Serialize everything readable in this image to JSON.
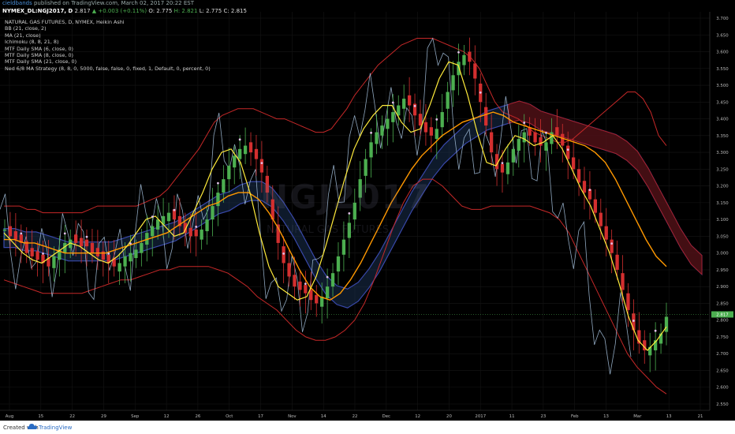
{
  "header": {
    "author": "cieldbands",
    "published": "published on TradingView.com, March 02, 2017 20:22 EST"
  },
  "symbol": {
    "ticker": "NYMEX_DL:NGJ2017, D",
    "last": "2.817",
    "change": "▲ +0.003 (+0.11%)",
    "o": "O: 2.775",
    "h": "H: 2.821",
    "l": "L: 2.775",
    "c": "C: 2.815"
  },
  "legend": {
    "title": "NATURAL GAS FUTURES, D, NYMEX, Heikin Ashi",
    "items": [
      "BB (21, close, 2)",
      "MA (21, close)",
      "Ichimoku (8, 8, 21, 8)",
      "MTF Daily SMA (6, close, 0)",
      "MTF Daily SMA (8, close, 0)",
      "MTF Daily SMA (21, close, 0)",
      "Ned 6/8 MA Strategy (8, 8, 0, 5000, false, false, 0, fixed, 1, Default, 0, percent, 0)"
    ]
  },
  "watermark": {
    "main": "NGJ2017",
    "sub": "NATURAL GAS FUTURES"
  },
  "footer": {
    "created": "Created with",
    "brand": "TradingView"
  },
  "colors": {
    "background": "#000000",
    "bull": "#4caf50",
    "bear": "#d32f2f",
    "bb_band": "#c62828",
    "ma21": "#ff9800",
    "sma6": "#ffeb3b",
    "kumo_bull": "#1e3a5f",
    "kumo_bear": "#5a0a0a",
    "chikou": "#a8c4e0",
    "price_label": "#4caf50"
  },
  "chart_data": {
    "type": "candlestick",
    "symbol": "NYMEX_DL:NGJ2017",
    "style": "Heikin Ashi",
    "y_axis": {
      "range": [
        2.55,
        3.7
      ],
      "ticks": [
        "3.700",
        "3.650",
        "3.600",
        "3.550",
        "3.500",
        "3.450",
        "3.400",
        "3.350",
        "3.300",
        "3.250",
        "3.200",
        "3.150",
        "3.100",
        "3.050",
        "3.000",
        "2.950",
        "2.900",
        "2.850",
        "2.800",
        "2.750",
        "2.700",
        "2.650",
        "2.600",
        "2.550"
      ],
      "last_price_label": "2.817"
    },
    "x_axis": {
      "ticks": [
        "Aug",
        "15",
        "22",
        "29",
        "Sep",
        "12",
        "26",
        "Oct",
        "17",
        "Nov",
        "14",
        "22",
        "Dec",
        "12",
        "20",
        "2017",
        "11",
        "23",
        "Feb",
        "13",
        "Mar",
        "13",
        "21"
      ]
    },
    "close_series": [
      3.07,
      3.05,
      3.04,
      3.03,
      3.0,
      2.99,
      2.98,
      2.97,
      2.96,
      2.99,
      3.01,
      3.03,
      3.04,
      3.03,
      3.02,
      3.02,
      3.0,
      2.99,
      2.98,
      2.97,
      2.96,
      2.97,
      2.99,
      3.0,
      3.01,
      3.03,
      3.06,
      3.08,
      3.1,
      3.11,
      3.12,
      3.1,
      3.08,
      3.06,
      3.05,
      3.05,
      3.07,
      3.1,
      3.14,
      3.18,
      3.22,
      3.26,
      3.29,
      3.31,
      3.32,
      3.3,
      3.28,
      3.24,
      3.18,
      3.1,
      3.03,
      2.97,
      2.93,
      2.9,
      2.89,
      2.88,
      2.86,
      2.85,
      2.87,
      2.9,
      2.94,
      2.99,
      3.04,
      3.09,
      3.15,
      3.22,
      3.28,
      3.33,
      3.36,
      3.38,
      3.4,
      3.42,
      3.44,
      3.46,
      3.44,
      3.41,
      3.38,
      3.36,
      3.35,
      3.37,
      3.42,
      3.48,
      3.53,
      3.57,
      3.59,
      3.57,
      3.52,
      3.45,
      3.38,
      3.3,
      3.25,
      3.24,
      3.27,
      3.31,
      3.34,
      3.36,
      3.35,
      3.33,
      3.32,
      3.33,
      3.36,
      3.35,
      3.32,
      3.28,
      3.25,
      3.21,
      3.18,
      3.16,
      3.12,
      3.08,
      3.04,
      3.0,
      2.95,
      2.89,
      2.83,
      2.77,
      2.73,
      2.71,
      2.72,
      2.74,
      2.76,
      2.81
    ],
    "bb_upper": [
      3.14,
      3.14,
      3.14,
      3.13,
      3.13,
      3.12,
      3.12,
      3.12,
      3.12,
      3.12,
      3.12,
      3.13,
      3.14,
      3.14,
      3.14,
      3.14,
      3.14,
      3.14,
      3.15,
      3.16,
      3.17,
      3.19,
      3.22,
      3.25,
      3.28,
      3.31,
      3.35,
      3.39,
      3.41,
      3.42,
      3.43,
      3.43,
      3.43,
      3.42,
      3.41,
      3.4,
      3.4,
      3.39,
      3.38,
      3.37,
      3.36,
      3.36,
      3.37,
      3.4,
      3.43,
      3.47,
      3.5,
      3.53,
      3.56,
      3.58,
      3.6,
      3.62,
      3.63,
      3.64,
      3.64,
      3.64,
      3.63,
      3.62,
      3.61,
      3.6,
      3.58,
      3.55,
      3.5,
      3.45,
      3.42,
      3.41,
      3.4,
      3.38,
      3.36,
      3.35,
      3.34,
      3.33,
      3.33,
      3.34,
      3.36,
      3.38,
      3.4,
      3.42,
      3.44,
      3.46,
      3.48,
      3.48,
      3.46,
      3.42,
      3.35,
      3.32
    ],
    "bb_lower": [
      2.92,
      2.91,
      2.9,
      2.89,
      2.88,
      2.88,
      2.88,
      2.88,
      2.88,
      2.89,
      2.9,
      2.91,
      2.92,
      2.92,
      2.93,
      2.94,
      2.95,
      2.95,
      2.96,
      2.96,
      2.96,
      2.96,
      2.95,
      2.94,
      2.92,
      2.9,
      2.87,
      2.85,
      2.83,
      2.8,
      2.77,
      2.75,
      2.74,
      2.74,
      2.75,
      2.77,
      2.8,
      2.85,
      2.92,
      3.0,
      3.08,
      3.15,
      3.2,
      3.22,
      3.22,
      3.2,
      3.17,
      3.14,
      3.13,
      3.13,
      3.14,
      3.14,
      3.14,
      3.14,
      3.14,
      3.13,
      3.12,
      3.1,
      3.06,
      3.0,
      2.94,
      2.88,
      2.82,
      2.76,
      2.7,
      2.66,
      2.63,
      2.6,
      2.58
    ],
    "ma21": [
      3.04,
      3.04,
      3.03,
      3.03,
      3.02,
      3.01,
      3.0,
      3.0,
      3.0,
      3.0,
      3.0,
      3.01,
      3.02,
      3.03,
      3.04,
      3.05,
      3.06,
      3.08,
      3.1,
      3.12,
      3.14,
      3.15,
      3.17,
      3.18,
      3.18,
      3.16,
      3.12,
      3.07,
      3.01,
      2.95,
      2.9,
      2.87,
      2.86,
      2.88,
      2.92,
      2.97,
      3.03,
      3.09,
      3.15,
      3.2,
      3.25,
      3.29,
      3.32,
      3.35,
      3.37,
      3.39,
      3.4,
      3.41,
      3.42,
      3.41,
      3.39,
      3.38,
      3.37,
      3.36,
      3.35,
      3.34,
      3.33,
      3.32,
      3.3,
      3.27,
      3.22,
      3.16,
      3.1,
      3.04,
      2.99,
      2.96
    ],
    "sma6": [
      3.06,
      3.03,
      3.0,
      2.98,
      2.97,
      2.99,
      3.01,
      3.03,
      3.02,
      3.0,
      2.98,
      2.97,
      2.99,
      3.02,
      3.06,
      3.1,
      3.11,
      3.08,
      3.05,
      3.06,
      3.12,
      3.18,
      3.25,
      3.3,
      3.31,
      3.27,
      3.18,
      3.06,
      2.96,
      2.9,
      2.88,
      2.86,
      2.87,
      2.93,
      3.02,
      3.12,
      3.22,
      3.31,
      3.37,
      3.41,
      3.44,
      3.44,
      3.39,
      3.36,
      3.37,
      3.44,
      3.52,
      3.57,
      3.56,
      3.47,
      3.36,
      3.27,
      3.26,
      3.31,
      3.35,
      3.34,
      3.32,
      3.33,
      3.35,
      3.31,
      3.25,
      3.19,
      3.14,
      3.07,
      3.0,
      2.91,
      2.81,
      2.74,
      2.71,
      2.74,
      2.78
    ]
  }
}
